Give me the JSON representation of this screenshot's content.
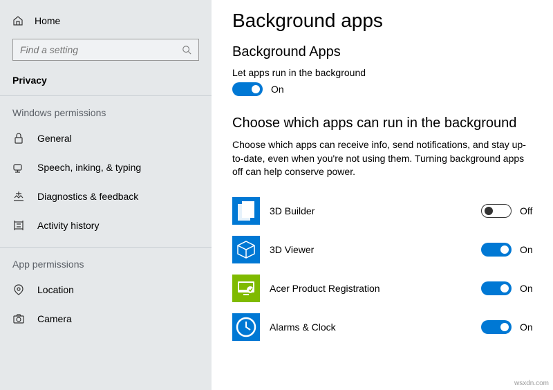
{
  "sidebar": {
    "home": "Home",
    "search_placeholder": "Find a setting",
    "section": "Privacy",
    "group1": "Windows permissions",
    "items1": [
      {
        "label": "General"
      },
      {
        "label": "Speech, inking, & typing"
      },
      {
        "label": "Diagnostics & feedback"
      },
      {
        "label": "Activity history"
      }
    ],
    "group2": "App permissions",
    "items2": [
      {
        "label": "Location"
      },
      {
        "label": "Camera"
      }
    ]
  },
  "main": {
    "title": "Background apps",
    "heading1": "Background Apps",
    "let_label": "Let apps run in the background",
    "master_state": "On",
    "heading2": "Choose which apps can run in the background",
    "desc": "Choose which apps can receive info, send notifications, and stay up-to-date, even when you're not using them. Turning background apps off can help conserve power.",
    "apps": [
      {
        "name": "3D Builder",
        "state": "Off",
        "color": "#0078d4"
      },
      {
        "name": "3D Viewer",
        "state": "On",
        "color": "#0078d4"
      },
      {
        "name": "Acer Product Registration",
        "state": "On",
        "color": "#7fba00"
      },
      {
        "name": "Alarms & Clock",
        "state": "On",
        "color": "#0078d4"
      }
    ]
  },
  "watermark": "wsxdn.com"
}
